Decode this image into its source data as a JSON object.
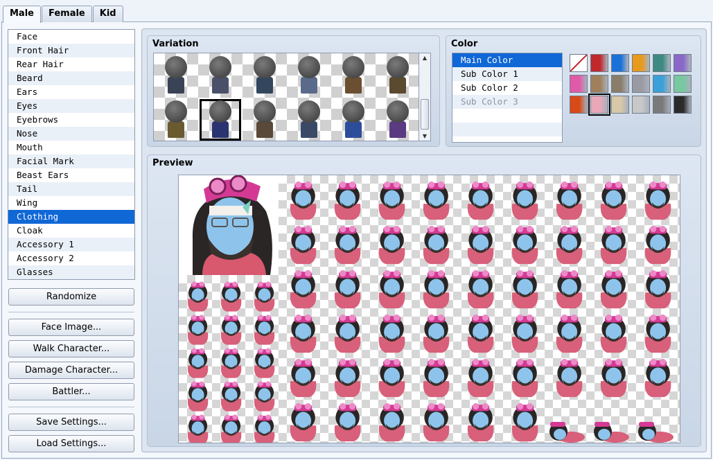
{
  "tabs": [
    "Male",
    "Female",
    "Kid"
  ],
  "active_tab": 0,
  "parts": [
    "Face",
    "Front Hair",
    "Rear Hair",
    "Beard",
    "Ears",
    "Eyes",
    "Eyebrows",
    "Nose",
    "Mouth",
    "Facial Mark",
    "Beast Ears",
    "Tail",
    "Wing",
    "Clothing",
    "Cloak",
    "Accessory 1",
    "Accessory 2",
    "Glasses"
  ],
  "selected_part": 13,
  "buttons": {
    "randomize": "Randomize",
    "face_image": "Face Image...",
    "walk_character": "Walk Character...",
    "damage_character": "Damage Character...",
    "battler": "Battler...",
    "save_settings": "Save Settings...",
    "load_settings": "Load Settings..."
  },
  "variation": {
    "title": "Variation",
    "selected_index": 7,
    "body_colors": [
      "#3a4256",
      "#4a5068",
      "#34465e",
      "#5a6a8a",
      "#6a5030",
      "#5a4a30",
      "#6a5a30",
      "#2a3470",
      "#5a4838",
      "#3a4a66",
      "#2c4e9a",
      "#5a3a80"
    ]
  },
  "color": {
    "title": "Color",
    "items": [
      "Main Color",
      "Sub Color 1",
      "Sub Color 2",
      "Sub Color 3"
    ],
    "selected_index": 0,
    "disabled_index": 3,
    "swatches": [
      "none",
      "#c0282c",
      "#1a72d8",
      "#e89a1c",
      "#3e8a82",
      "#8a68c8",
      "#e05aa8",
      "#a0805c",
      "#8a7e6a",
      "#9a9aa2",
      "#3aa0d8",
      "#78c8a0",
      "#d84a18",
      "#e8a8b8",
      "#d8c8a8",
      "#c8c8c8",
      "#7a7a7a",
      "#2a2a2a"
    ],
    "selected_swatch": 13
  },
  "preview": {
    "title": "Preview"
  }
}
